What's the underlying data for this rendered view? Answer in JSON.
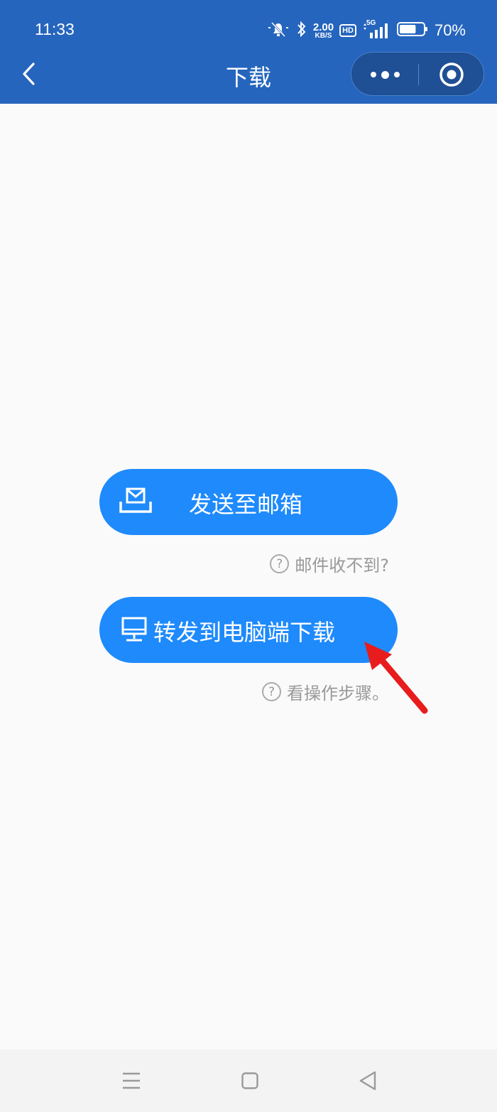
{
  "status_bar": {
    "time": "11:33",
    "net_speed_value": "2.00",
    "net_speed_unit": "KB/S",
    "hd_badge": "HD",
    "network_type": "5G",
    "battery_percent": "70%",
    "battery_level": 0.7
  },
  "nav": {
    "title": "下载"
  },
  "actions": {
    "send_email_label": "发送至邮箱",
    "email_help": "邮件收不到?",
    "forward_pc_label": "转发到电脑端下载",
    "pc_help": "看操作步骤。",
    "help_mark": "?"
  },
  "colors": {
    "nav_bar": "#2565bd",
    "button": "#1e8afc",
    "annotation_arrow": "#e81c1c",
    "background": "#fafafa"
  },
  "icons": {
    "mute": "bell-off-icon",
    "bluetooth": "bluetooth-icon",
    "signal": "signal-icon",
    "battery": "battery-icon",
    "back": "chevron-left-icon",
    "more": "more-dots-icon",
    "close": "target-circle-icon",
    "mail": "mail-tray-icon",
    "monitor": "monitor-icon",
    "menu": "menu-icon",
    "home": "square-icon",
    "nav_back": "triangle-back-icon"
  }
}
